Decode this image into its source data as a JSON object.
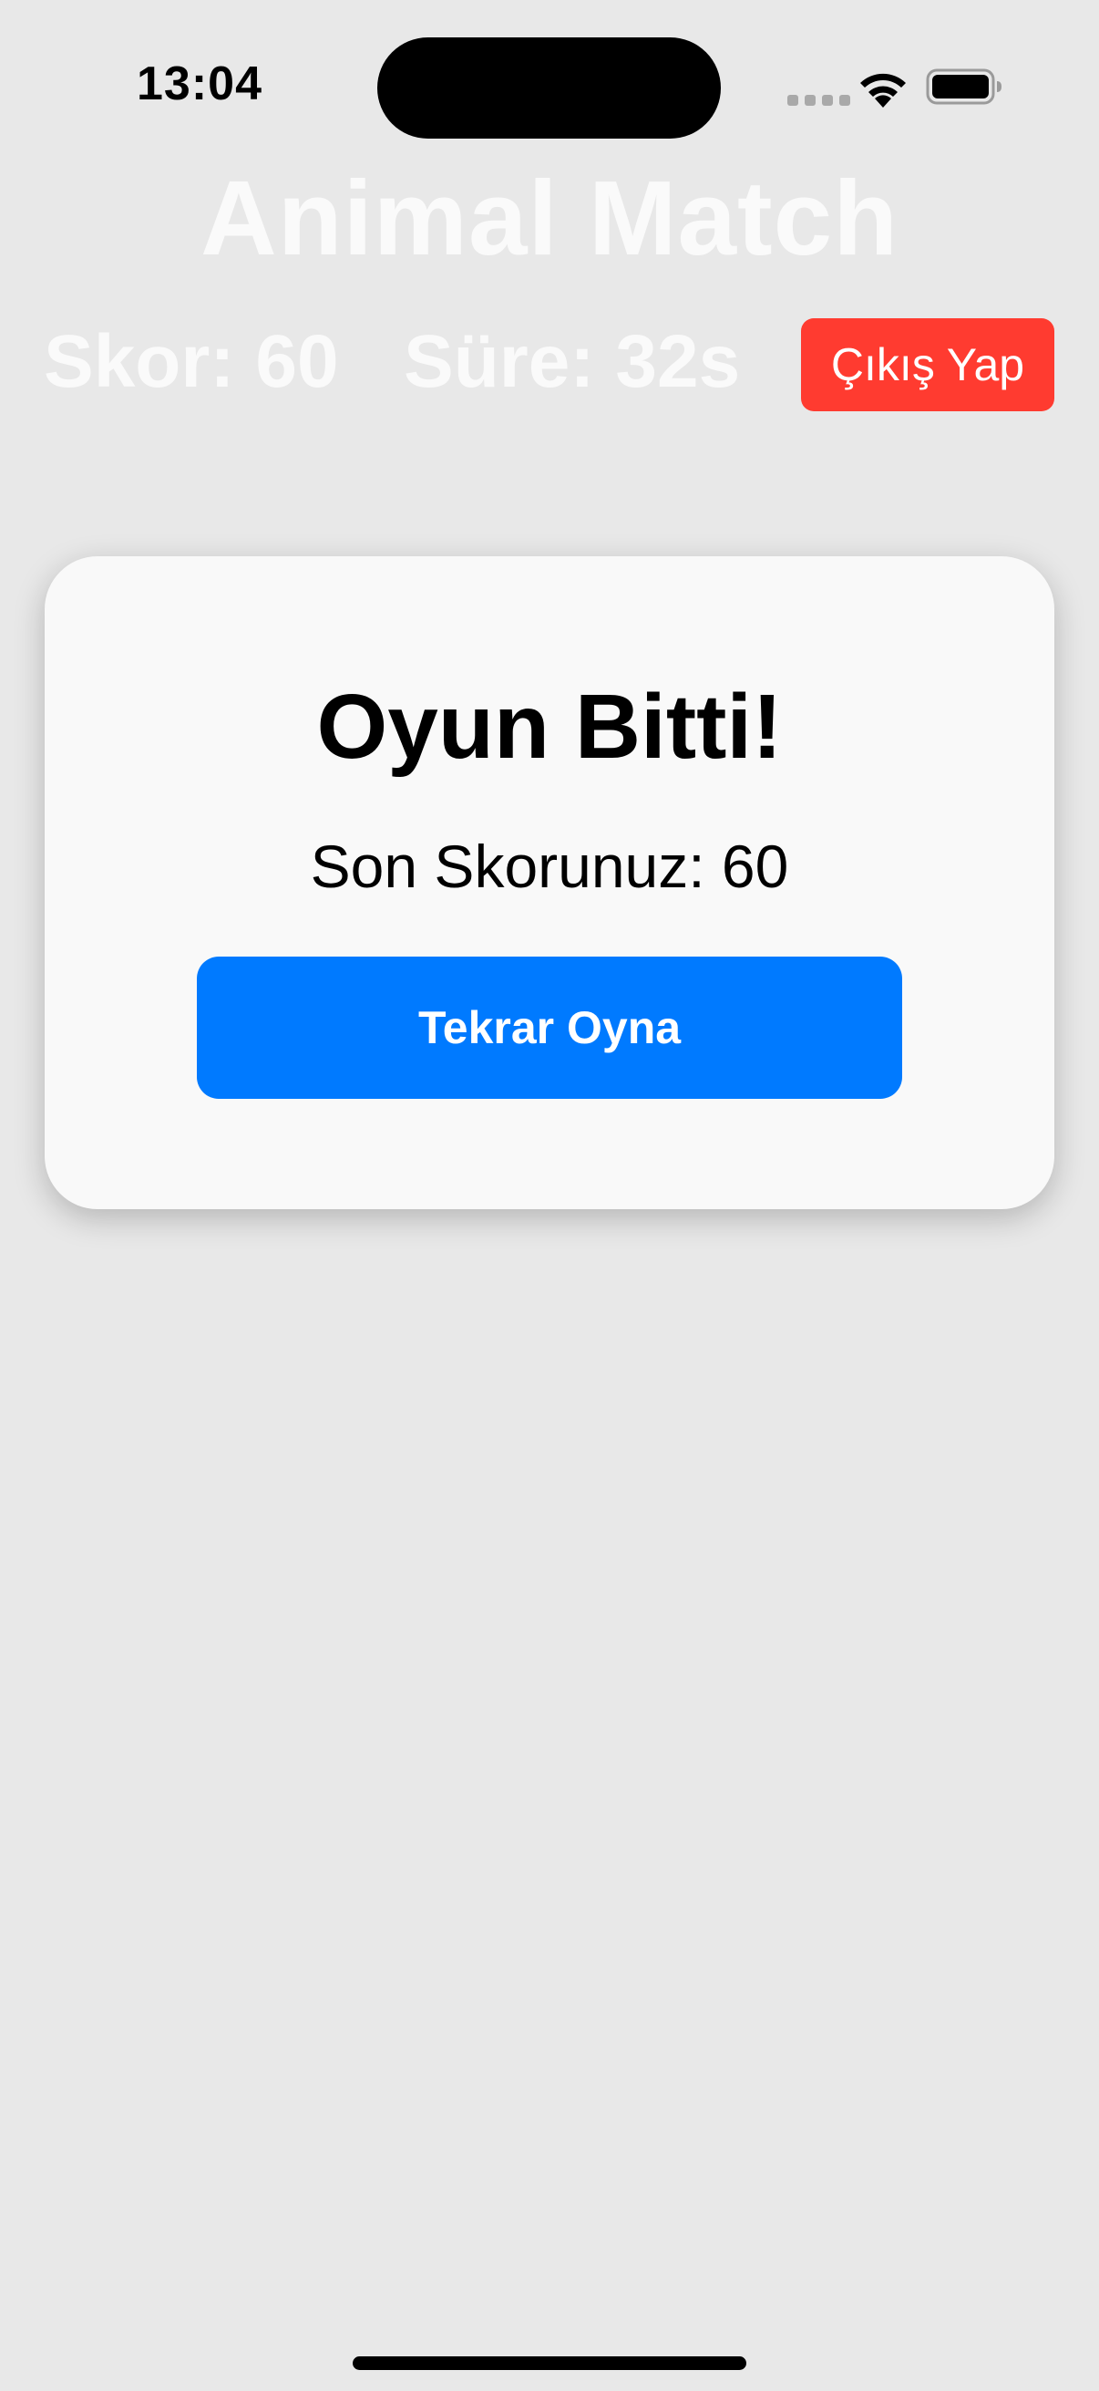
{
  "status_bar": {
    "time": "13:04",
    "wifi_icon": "wifi-icon",
    "battery_icon": "battery-icon",
    "cellular_icon": "cellular-dots-icon"
  },
  "header": {
    "title": "Animal Match",
    "score_text": "Skor: 60",
    "time_text": "Süre: 32s",
    "exit_label": "Çıkış Yap"
  },
  "game_over": {
    "title": "Oyun Bitti!",
    "final_score_text": "Son Skorunuz: 60",
    "replay_label": "Tekrar Oyna"
  },
  "colors": {
    "background": "#e8e8e8",
    "header_text": "#fafafa",
    "exit_button": "#ff3b30",
    "primary_button": "#007aff",
    "card": "#f9f9f9"
  }
}
